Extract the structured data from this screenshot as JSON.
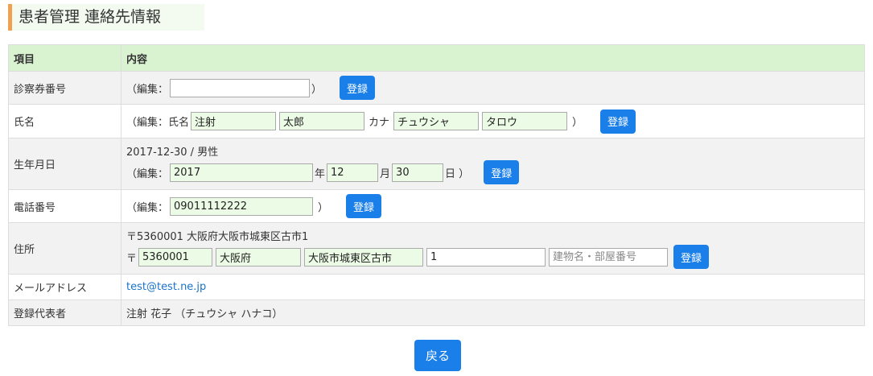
{
  "page_title": "患者管理 連絡先情報",
  "table": {
    "header_item": "項目",
    "header_content": "内容"
  },
  "colors": {
    "accent_bar": "#f0a050",
    "header_bg": "#d9f2d0",
    "button": "#1a7fe8",
    "filled_input": "#ecfbe6"
  },
  "rows": {
    "card": {
      "label": "診察券番号",
      "edit_open": "（編集：",
      "value": "",
      "edit_close": "）",
      "button": "登録"
    },
    "name": {
      "label": "氏名",
      "edit_open": "（編集：氏名",
      "last_name": "注射",
      "first_name": "太郎",
      "kana_label": "カナ",
      "last_kana": "チュウシャ",
      "first_kana": "タロウ",
      "edit_close": "）",
      "button": "登録"
    },
    "birth": {
      "label": "生年月日",
      "summary": "2017-12-30 / 男性",
      "edit_open": "（編集：",
      "year": "2017",
      "year_unit": "年",
      "month": "12",
      "month_unit": "月",
      "day": "30",
      "day_unit": "日 ）",
      "button": "登録"
    },
    "phone": {
      "label": "電話番号",
      "edit_open": "（編集：",
      "value": "09011112222",
      "edit_close": "）",
      "button": "登録"
    },
    "address": {
      "label": "住所",
      "summary": "〒5360001 大阪府大阪市城東区古市1",
      "postal_mark": "〒",
      "postal": "5360001",
      "prefecture": "大阪府",
      "city": "大阪市城東区古市",
      "street": "1",
      "building_placeholder": "建物名・部屋番号",
      "button": "登録"
    },
    "email": {
      "label": "メールアドレス",
      "value": "test@test.ne.jp"
    },
    "representative": {
      "label": "登録代表者",
      "value": "注射 花子 （チュウシャ ハナコ）"
    }
  },
  "back_button": "戻る"
}
